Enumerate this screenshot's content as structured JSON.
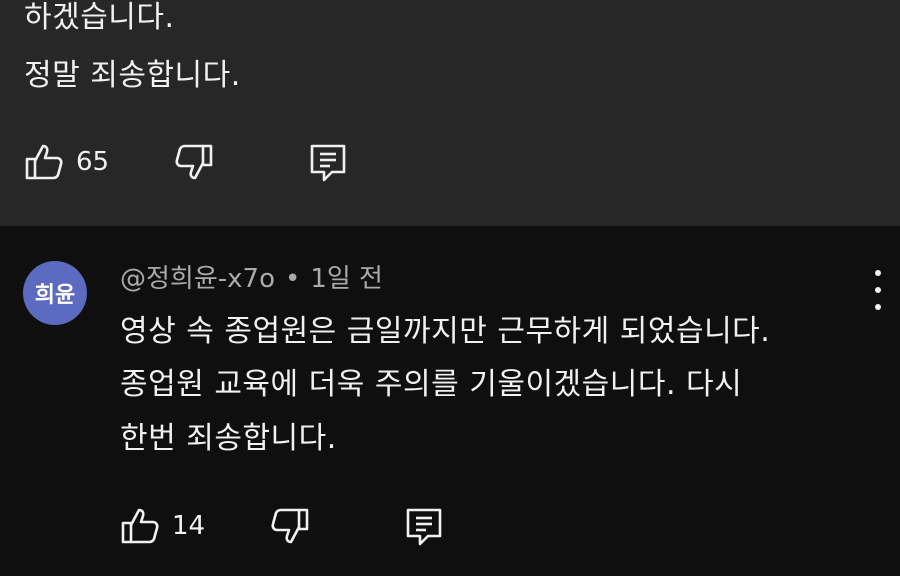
{
  "comment_prev": {
    "lines": [
      "하겠습니다.",
      "정말 죄송합니다."
    ],
    "like_count": "65"
  },
  "comment": {
    "avatar_text": "희윤",
    "handle": "@정희윤-x7o",
    "separator": "•",
    "time": "1일 전",
    "lines": [
      "영상 속 종업원은 금일까지만 근무하게 되었습니다.",
      "종업원 교육에 더욱 주의를 기울이겠습니다. 다시",
      "한번 죄송합니다."
    ],
    "like_count": "14"
  },
  "icons": {
    "like": "thumbs-up-icon",
    "dislike": "thumbs-down-icon",
    "reply": "reply-comment-icon",
    "more": "more-vertical-icon"
  },
  "colors": {
    "card_prev_bg": "#272727",
    "page_bg": "#0f0f0f",
    "avatar_bg": "#5c6bc0",
    "text_primary": "#f1f1f1",
    "text_secondary": "#aaaaaa"
  }
}
